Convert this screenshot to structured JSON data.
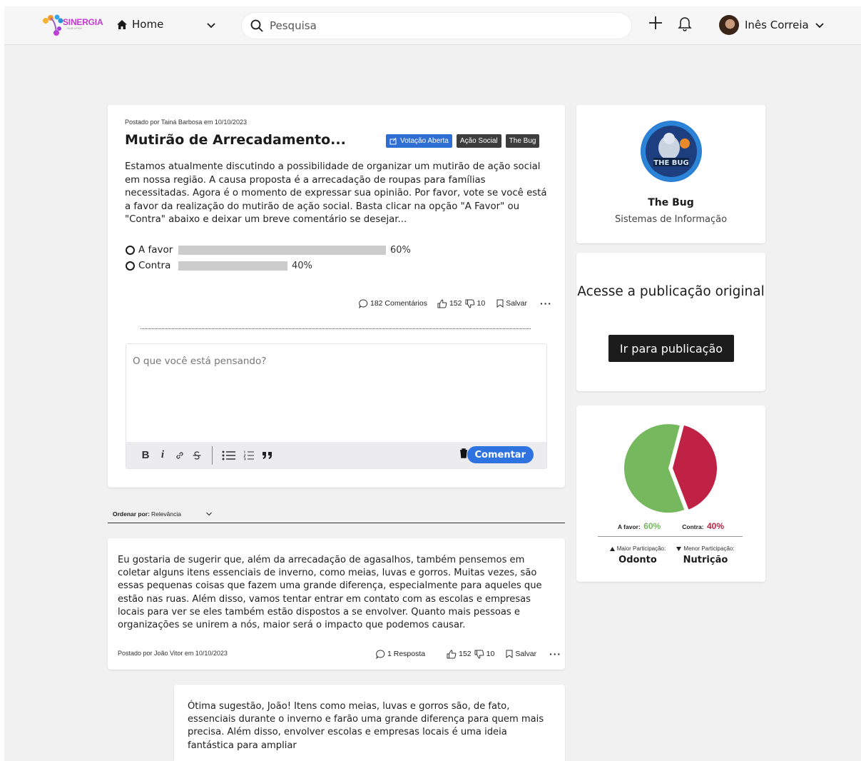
{
  "header": {
    "logo_text": "SINERGIA",
    "logo_sub": "HUB UFSM",
    "home_label": "Home",
    "search_placeholder": "Pesquisa",
    "user_name": "Inês Correia"
  },
  "post": {
    "meta": "Postado por Tainá Barbosa em 10/10/2023",
    "title": "Mutirão de Arrecadamento...",
    "tags": [
      "Votação Aberta",
      "Ação Social",
      "The Bug"
    ],
    "body": "Estamos atualmente discutindo a possibilidade de organizar um mutirão de ação social em nossa região. A causa proposta é a arrecadação de roupas para famílias necessitadas. Agora é o momento de expressar sua opinião. Por favor, vote se você está a favor da realização do mutirão de ação social. Basta clicar na opção \"A Favor\" ou \"Contra\" abaixo e deixar um breve comentário se desejar...",
    "poll": [
      {
        "label": "A favor",
        "percent": 60,
        "percent_label": "60%"
      },
      {
        "label": "Contra",
        "percent": 40,
        "percent_label": "40%"
      }
    ],
    "comments_label": "182 Comentários",
    "likes": "152",
    "dislikes": "10",
    "save_label": "Salvar",
    "composer_placeholder": "O que você está pensando?",
    "comment_button": "Comentar"
  },
  "sort": {
    "label": "Ordenar por:",
    "value": "Relevância"
  },
  "comments": [
    {
      "text": "Eu gostaria de sugerir que, além da arrecadação de agasalhos, também pensemos em coletar alguns itens essenciais de inverno, como meias, luvas e gorros. Muitas vezes, são essas pequenas coisas que fazem uma grande diferença, especialmente para aqueles que estão nas ruas. Além disso, vamos tentar entrar em contato com as escolas e empresas locais para ver se eles também estão dispostos a se envolver. Quanto mais pessoas e organizações se unirem a nós, maior será o impacto que podemos causar.",
      "meta": "Postado por João Vitor em 10/10/2023",
      "replies_label": "1 Resposta",
      "likes": "152",
      "dislikes": "10",
      "save_label": "Salvar"
    },
    {
      "text": "Ótima sugestão, João! Itens como meias, luvas e gorros são, de fato, essenciais durante o inverno e farão uma grande diferença para quem mais precisa. Além disso, envolver escolas e empresas locais é uma ideia fantástica para ampliar"
    }
  ],
  "profile": {
    "logo_text": "THE BUG",
    "name": "The Bug",
    "subtitle": "Sistemas de Informação"
  },
  "access": {
    "title": "Acesse a publicação original",
    "button": "Ir para publicação"
  },
  "stats": {
    "favor_label": "A favor:",
    "favor_value": "60%",
    "contra_label": "Contra:",
    "contra_value": "40%",
    "max_label": "Maior Participação:",
    "max_value": "Odonto",
    "min_label": "Menor Participação:",
    "min_value": "Nutrição",
    "colors": {
      "favor": "#75b85e",
      "contra": "#bf2244"
    }
  },
  "chart_data": {
    "type": "pie",
    "categories": [
      "A favor",
      "Contra"
    ],
    "values": [
      60,
      40
    ]
  }
}
